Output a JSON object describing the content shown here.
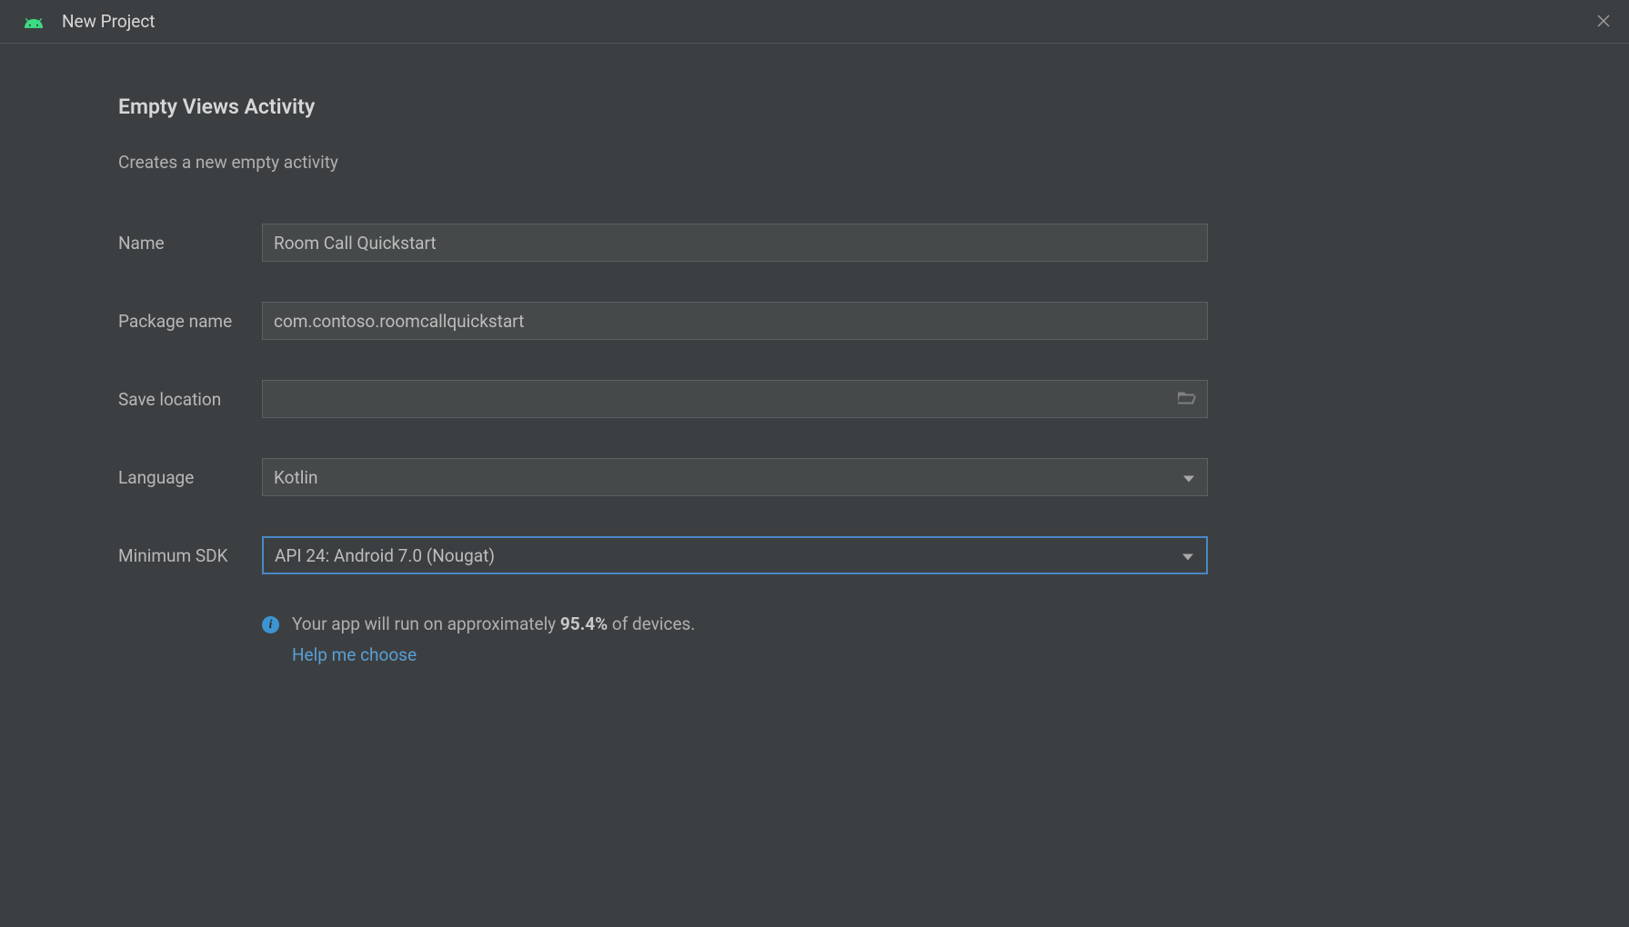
{
  "titlebar": {
    "title": "New Project"
  },
  "page": {
    "title": "Empty Views Activity",
    "subtitle": "Creates a new empty activity"
  },
  "form": {
    "name": {
      "label": "Name",
      "value": "Room Call Quickstart"
    },
    "package": {
      "label": "Package name",
      "value": "com.contoso.roomcallquickstart"
    },
    "save_location": {
      "label": "Save location",
      "value": ""
    },
    "language": {
      "label": "Language",
      "value": "Kotlin"
    },
    "min_sdk": {
      "label": "Minimum SDK",
      "value": "API 24: Android 7.0 (Nougat)"
    }
  },
  "info": {
    "prefix": "Your app will run on approximately ",
    "percentage": "95.4%",
    "suffix": " of devices.",
    "help_link": "Help me choose"
  }
}
